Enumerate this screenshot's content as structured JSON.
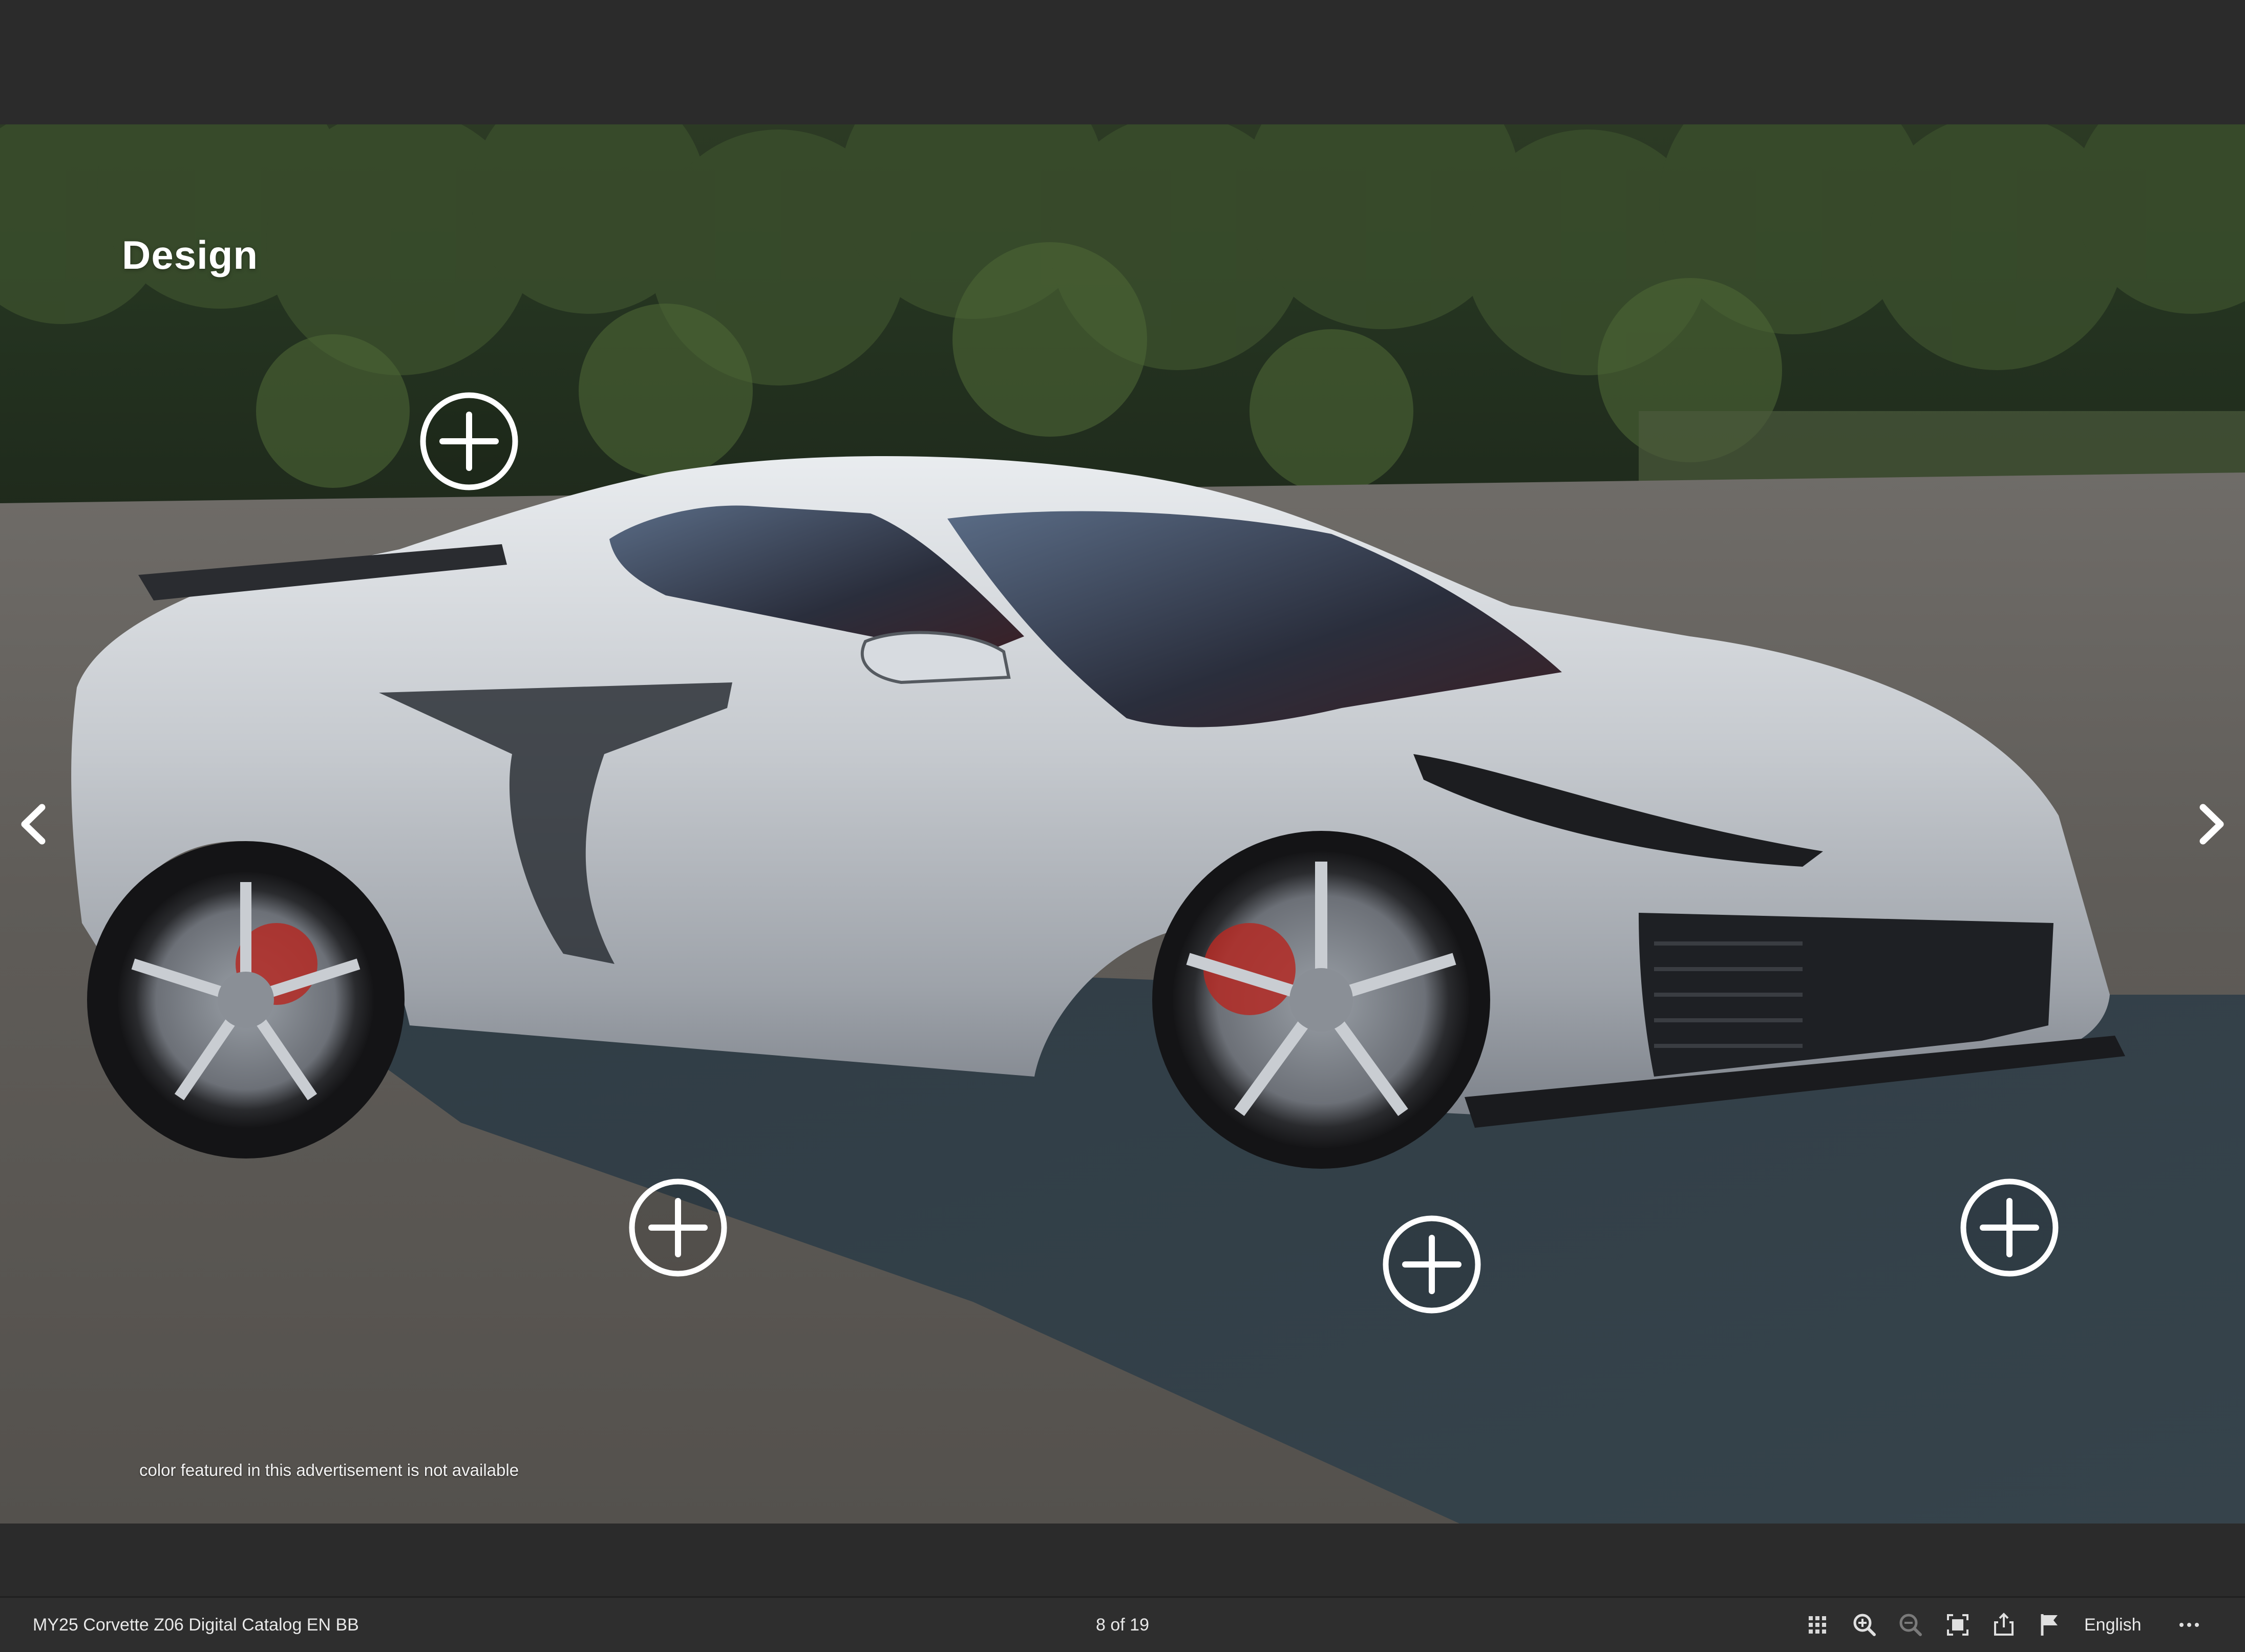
{
  "document": {
    "title": "MY25 Corvette Z06 Digital Catalog EN BB",
    "page_indicator": "8 of 19"
  },
  "page": {
    "heading": "Design",
    "disclaimer": "color featured in this advertisement is not available",
    "hotspots": [
      {
        "icon": "plus-circle-icon"
      },
      {
        "icon": "plus-circle-icon"
      },
      {
        "icon": "plus-circle-icon"
      },
      {
        "icon": "plus-circle-icon"
      }
    ],
    "prev_icon": "chevron-left-icon",
    "next_icon": "chevron-right-icon",
    "image_subject": "silver sports car on asphalt"
  },
  "toolbar": {
    "language": "English",
    "icons": [
      "grid-icon",
      "zoom-in-icon",
      "zoom-out-icon",
      "fit-page-icon",
      "share-icon",
      "flag-icon",
      "more-icon"
    ]
  },
  "colors": {
    "chrome_background": "#2b2b2b",
    "toolbar_background": "#2e2e2e",
    "text": "#e8e8e8",
    "hotspot": "#ffffff"
  }
}
